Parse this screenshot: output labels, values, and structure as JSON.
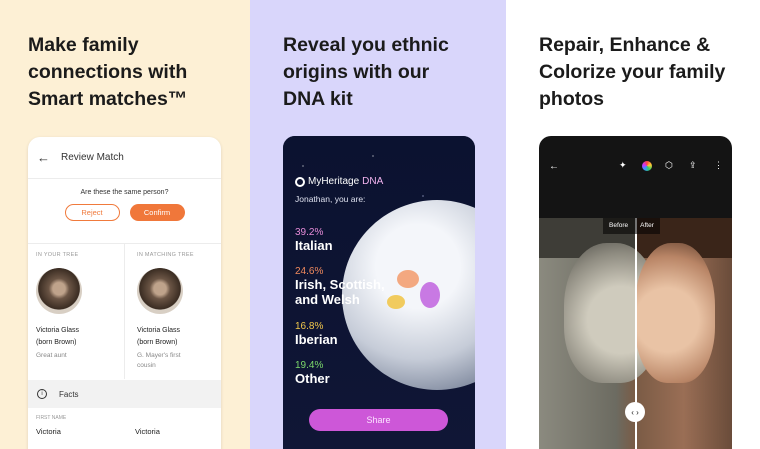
{
  "panels": [
    {
      "headline": [
        "Make family",
        "connections with",
        "Smart matches™"
      ]
    },
    {
      "headline": [
        "Reveal you ethnic",
        "origins with our",
        "DNA kit"
      ]
    },
    {
      "headline": [
        "Repair, Enhance &",
        "Colorize your family",
        "photos"
      ]
    }
  ],
  "review": {
    "title": "Review Match",
    "question": "Are these the same person?",
    "reject_label": "Reject",
    "confirm_label": "Confirm",
    "your_tree_caption": "IN YOUR TREE",
    "matching_tree_caption": "IN MATCHING TREE",
    "left": {
      "name1": "Victoria Glass",
      "name2": "(born Brown)",
      "relation": "Great aunt"
    },
    "right": {
      "name1": "Victoria Glass",
      "name2": "(born Brown)",
      "relation1": "G. Mayer's first",
      "relation2": "cousin"
    },
    "facts_label": "Facts",
    "first_name_caption": "FIRST NAME",
    "first_name_left": "Victoria",
    "first_name_right": "Victoria"
  },
  "dna": {
    "brand": "MyHeritage",
    "brand_dna": "DNA",
    "subtitle": "Jonathan, you are:",
    "ethnicities": [
      {
        "pct": "39.2%",
        "name": "Italian",
        "color": "#e58bd8"
      },
      {
        "pct": "24.6%",
        "name": "Irish, Scottish, and Welsh",
        "color": "#f08a5d"
      },
      {
        "pct": "16.8%",
        "name": "Iberian",
        "color": "#f1c74c"
      },
      {
        "pct": "19.4%",
        "name": "Other",
        "color": "#7bd96b"
      }
    ],
    "share_label": "Share"
  },
  "photo": {
    "before_label": "Before",
    "after_label": "After",
    "handle_symbol": "‹ ›"
  }
}
